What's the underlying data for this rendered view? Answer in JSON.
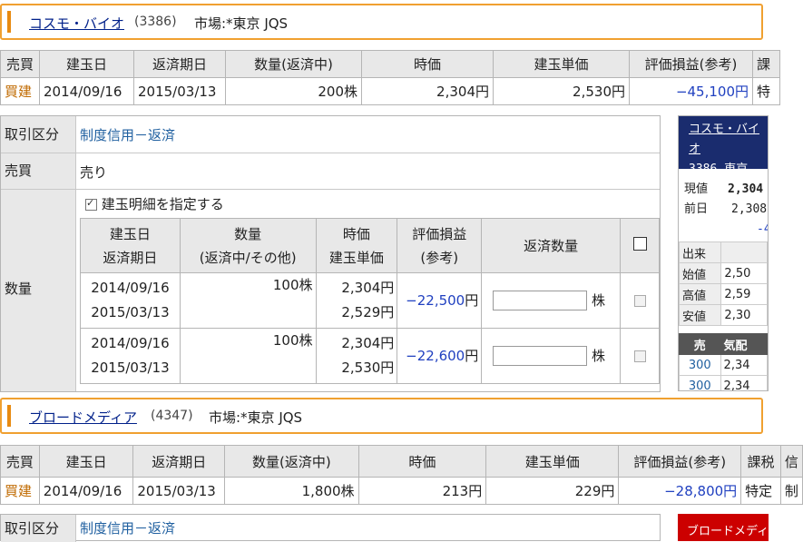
{
  "stock1": {
    "name": "コスモ・バイオ",
    "code": "(3386)",
    "market": "市場:*東京 JQS",
    "headers": [
      "売買",
      "建玉日",
      "返済期日",
      "数量(返済中)",
      "時価",
      "建玉単価",
      "評価損益(参考)",
      "課"
    ],
    "row": [
      "買建",
      "2014/09/16",
      "2015/03/13",
      "200株",
      "2,304円",
      "2,530円",
      "−45,100円",
      "特"
    ]
  },
  "form": {
    "trade_type_label": "取引区分",
    "trade_type_value": "制度信用－返済",
    "side_label": "売買",
    "side_value": "売り",
    "qty_label": "数量",
    "detail_checkbox_label": "建玉明細を指定する",
    "detail_headers": {
      "date1": "建玉日",
      "date2": "返済期日",
      "qty1": "数量",
      "qty2": "(返済中/その他)",
      "price1": "時価",
      "price2": "建玉単価",
      "pl1": "評価損益",
      "pl2": "(参考)",
      "repay": "返済数量"
    },
    "detail_rows": [
      {
        "date": "2014/09/16",
        "due": "2015/03/13",
        "qty": "100株",
        "price": "2,304円",
        "cost": "2,529円",
        "pl": "−22,500",
        "pl_unit": "円",
        "unit": "株"
      },
      {
        "date": "2014/09/16",
        "due": "2015/03/13",
        "qty": "100株",
        "price": "2,304円",
        "cost": "2,530円",
        "pl": "−22,600",
        "pl_unit": "円",
        "unit": "株"
      }
    ]
  },
  "quote": {
    "name": "コスモ・バイオ",
    "code_market": "3386 東京",
    "current_label": "現値",
    "current_value": "2,304",
    "prev_label": "前日",
    "prev_value": "2,308",
    "change": "-4",
    "volume_label": "出来",
    "open_label": "始値",
    "open_value": "2,50",
    "high_label": "高値",
    "high_value": "2,59",
    "low_label": "安値",
    "low_value": "2,30",
    "board_sell": "売",
    "board_kehai": "気配",
    "board_rows": [
      [
        "300",
        "2,34"
      ],
      [
        "300",
        "2,34"
      ]
    ]
  },
  "stock2": {
    "name": "ブロードメディア",
    "code": "(4347)",
    "market": "市場:*東京 JQS",
    "headers": [
      "売買",
      "建玉日",
      "返済期日",
      "数量(返済中)",
      "時価",
      "建玉単価",
      "評価損益(参考)",
      "課税",
      "信"
    ],
    "row": [
      "買建",
      "2014/09/16",
      "2015/03/13",
      "1,800株",
      "213円",
      "229円",
      "−28,800円",
      "特定",
      "制"
    ],
    "form_label": "取引区分",
    "form_value": "制度信用－返済",
    "quote_stub": "ブロードメディア"
  }
}
